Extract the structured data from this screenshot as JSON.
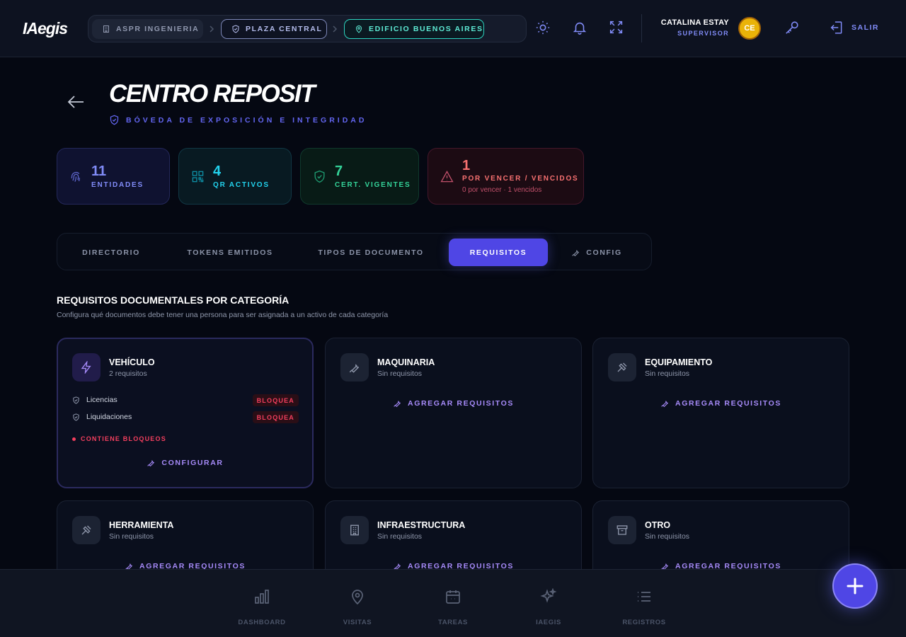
{
  "app": {
    "logo": "IAegis"
  },
  "breadcrumb": [
    {
      "label": "ASPR INGENIERIA",
      "icon": "building-icon"
    },
    {
      "label": "PLAZA CENTRAL",
      "icon": "shield-icon"
    },
    {
      "label": "EDIFICIO BUENOS AIRES",
      "icon": "map-pin-icon"
    }
  ],
  "user": {
    "name": "CATALINA ESTAY",
    "role": "SUPERVISOR",
    "initials": "CE"
  },
  "header_actions": {
    "logout_label": "SALIR"
  },
  "page": {
    "title": "CENTRO REPOSIT",
    "subtitle": "BÓVEDA DE EXPOSICIÓN E INTEGRIDAD"
  },
  "stats": [
    {
      "value": "11",
      "label": "ENTIDADES",
      "icon": "fingerprint-icon",
      "color": "#818cf8"
    },
    {
      "value": "4",
      "label": "QR ACTIVOS",
      "icon": "qr-code-icon",
      "color": "#22d3ee"
    },
    {
      "value": "7",
      "label": "CERT. VIGENTES",
      "icon": "shield-check-icon",
      "color": "#34d399"
    },
    {
      "value": "1",
      "label": "POR VENCER / VENCIDOS",
      "sub": "0 por vencer · 1 vencidos",
      "icon": "alert-triangle-icon",
      "color": "#f87171"
    }
  ],
  "tabs": [
    {
      "label": "DIRECTORIO",
      "active": false
    },
    {
      "label": "TOKENS EMITIDOS",
      "active": false
    },
    {
      "label": "TIPOS DE DOCUMENTO",
      "active": false
    },
    {
      "label": "REQUISITOS",
      "active": true
    },
    {
      "label": "CONFIG",
      "active": false,
      "icon": "wrench-icon"
    }
  ],
  "section": {
    "title": "REQUISITOS DOCUMENTALES POR CATEGORÍA",
    "description": "Configura qué documentos debe tener una persona para ser asignada a un activo de cada categoría"
  },
  "categories": [
    {
      "name": "VEHÍCULO",
      "count": "2 requisitos",
      "icon": "lightning-icon",
      "requirements": [
        {
          "name": "Licencias",
          "badge": "BLOQUEA"
        },
        {
          "name": "Liquidaciones",
          "badge": "BLOQUEA"
        }
      ],
      "warning": "CONTIENE BLOQUEOS",
      "action": "CONFIGURAR"
    },
    {
      "name": "MAQUINARIA",
      "count": "Sin requisitos",
      "icon": "wrench-icon",
      "action": "AGREGAR REQUISITOS"
    },
    {
      "name": "EQUIPAMIENTO",
      "count": "Sin requisitos",
      "icon": "tools-icon",
      "action": "AGREGAR REQUISITOS"
    },
    {
      "name": "HERRAMIENTA",
      "count": "Sin requisitos",
      "icon": "hammer-icon",
      "action": "AGREGAR REQUISITOS"
    },
    {
      "name": "INFRAESTRUCTURA",
      "count": "Sin requisitos",
      "icon": "building-icon",
      "action": "AGREGAR REQUISITOS"
    },
    {
      "name": "OTRO",
      "count": "Sin requisitos",
      "icon": "archive-icon",
      "action": "AGREGAR REQUISITOS"
    }
  ],
  "bottom_nav": [
    {
      "label": "DASHBOARD",
      "icon": "bar-chart-icon"
    },
    {
      "label": "VISITAS",
      "icon": "map-pin-icon"
    },
    {
      "label": "TAREAS",
      "icon": "calendar-icon"
    },
    {
      "label": "IAEGIS",
      "icon": "sparkles-icon"
    },
    {
      "label": "REGISTROS",
      "icon": "list-icon"
    }
  ],
  "colors": {
    "accent": "#4f46e5",
    "background": "#050812",
    "danger": "#f43f5e",
    "link": "#a78bfa"
  }
}
